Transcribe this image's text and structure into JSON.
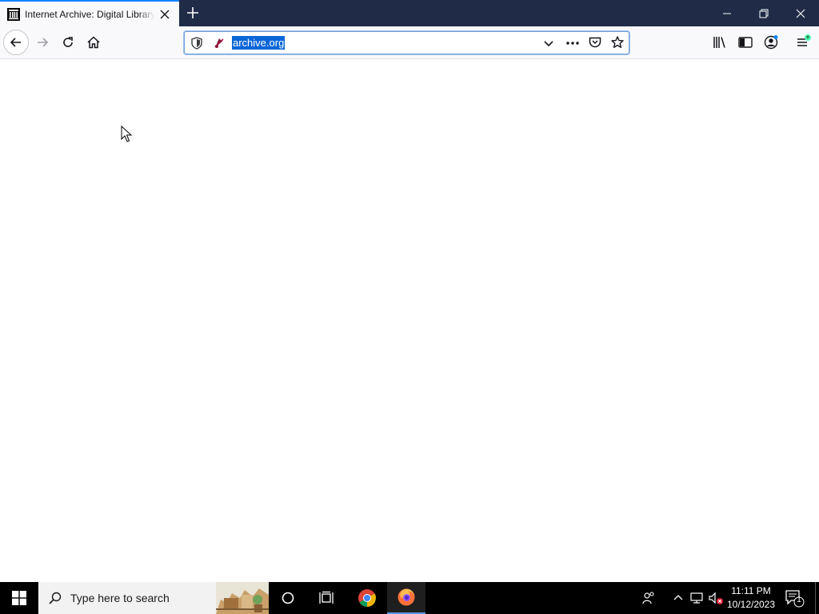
{
  "browser": {
    "tab": {
      "title": "Internet Archive: Digital Library of Free & Borrowable Books, Movies, Music & Wayback Machine",
      "favicon": "archive-building-icon"
    },
    "url": "archive.org"
  },
  "taskbar": {
    "search_placeholder": "Type here to search",
    "clock": {
      "time": "11:11 PM",
      "date": "10/12/2023"
    },
    "notification_count": "1"
  },
  "colors": {
    "tabbar": "#1f2b47",
    "accent": "#0a84ff",
    "url_selection": "#0a66d8",
    "taskbar": "#000000"
  }
}
